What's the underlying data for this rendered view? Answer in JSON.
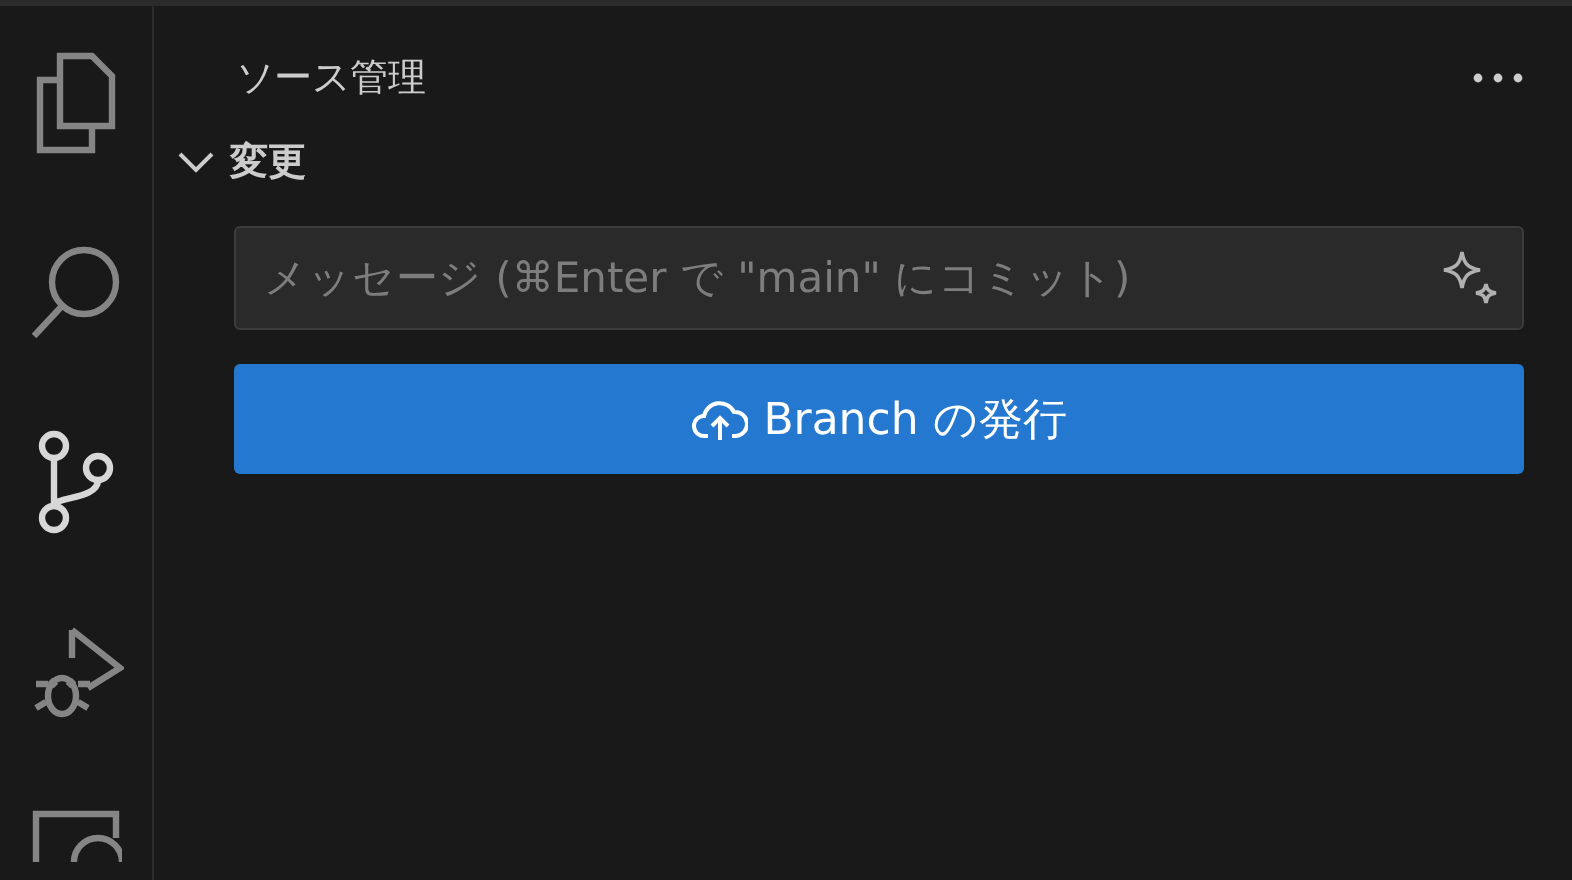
{
  "activity_bar": {
    "items": [
      {
        "kind": "files",
        "selected": false
      },
      {
        "kind": "search",
        "selected": false
      },
      {
        "kind": "source-control",
        "selected": true
      },
      {
        "kind": "run-debug",
        "selected": false
      },
      {
        "kind": "remote",
        "selected": false
      }
    ]
  },
  "panel": {
    "title": "ソース管理",
    "section": {
      "label": "変更",
      "expanded": true
    },
    "commit_field": {
      "placeholder": "メッセージ (⌘Enter で \"main\" にコミット)"
    },
    "publish_button": {
      "label": "Branch の発行"
    }
  }
}
